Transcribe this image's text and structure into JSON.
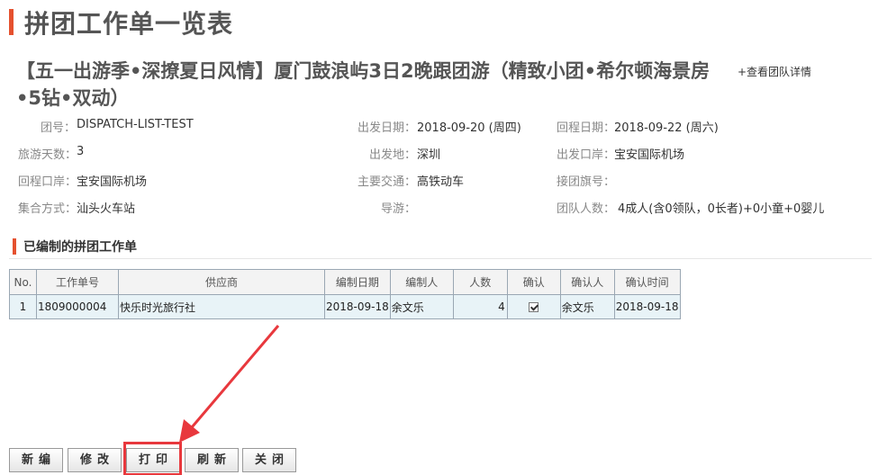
{
  "page": {
    "title": "拼团工作单一览表"
  },
  "tour": {
    "title_line1": "【五一出游季•深撩夏日风情】厦门鼓浪屿3日2晚跟团游（精致小团•希尔顿海景房",
    "title_line2": "•5钻•双动）",
    "detail_link": "+查看团队详情"
  },
  "info": {
    "group_no": {
      "label": "团号：",
      "value": "DISPATCH-LIST-TEST"
    },
    "depart_date": {
      "label": "出发日期：",
      "value": "2018-09-20 (周四)"
    },
    "return_date": {
      "label": "回程日期：",
      "value": "2018-09-22 (周六)"
    },
    "days": {
      "label": "旅游天数：",
      "value": "3"
    },
    "depart_place": {
      "label": "出发地：",
      "value": "深圳"
    },
    "depart_port": {
      "label": "出发口岸：",
      "value": "宝安国际机场"
    },
    "return_port": {
      "label": "回程口岸：",
      "value": "宝安国际机场"
    },
    "transport": {
      "label": "主要交通：",
      "value": "高铁动车"
    },
    "flag_no": {
      "label": "接团旗号：",
      "value": ""
    },
    "meeting": {
      "label": "集合方式：",
      "value": "汕头火车站"
    },
    "guide": {
      "label": "导游：",
      "value": ""
    },
    "headcount": {
      "label": "团队人数：",
      "value": "4成人(含0领队，0长者)+0小童+0婴儿"
    }
  },
  "section": {
    "title": "已编制的拼团工作单"
  },
  "table": {
    "headers": [
      "No.",
      "工作单号",
      "供应商",
      "编制日期",
      "编制人",
      "人数",
      "确认",
      "确认人",
      "确认时间"
    ],
    "rows": [
      {
        "no": "1",
        "order_no": "1809000004",
        "supplier": "快乐时光旅行社",
        "date": "2018-09-18",
        "creator": "余文乐",
        "count": "4",
        "confirmed": true,
        "confirmer": "余文乐",
        "confirm_time": "2018-09-18"
      }
    ]
  },
  "buttons": {
    "new": "新编",
    "edit": "修改",
    "print": "打印",
    "refresh": "刷新",
    "close": "关闭"
  },
  "colors": {
    "accent": "#e5512f",
    "annotation": "#e8383d",
    "row_bg": "#e8f3f7",
    "header_bg": "#f3f3f3"
  }
}
